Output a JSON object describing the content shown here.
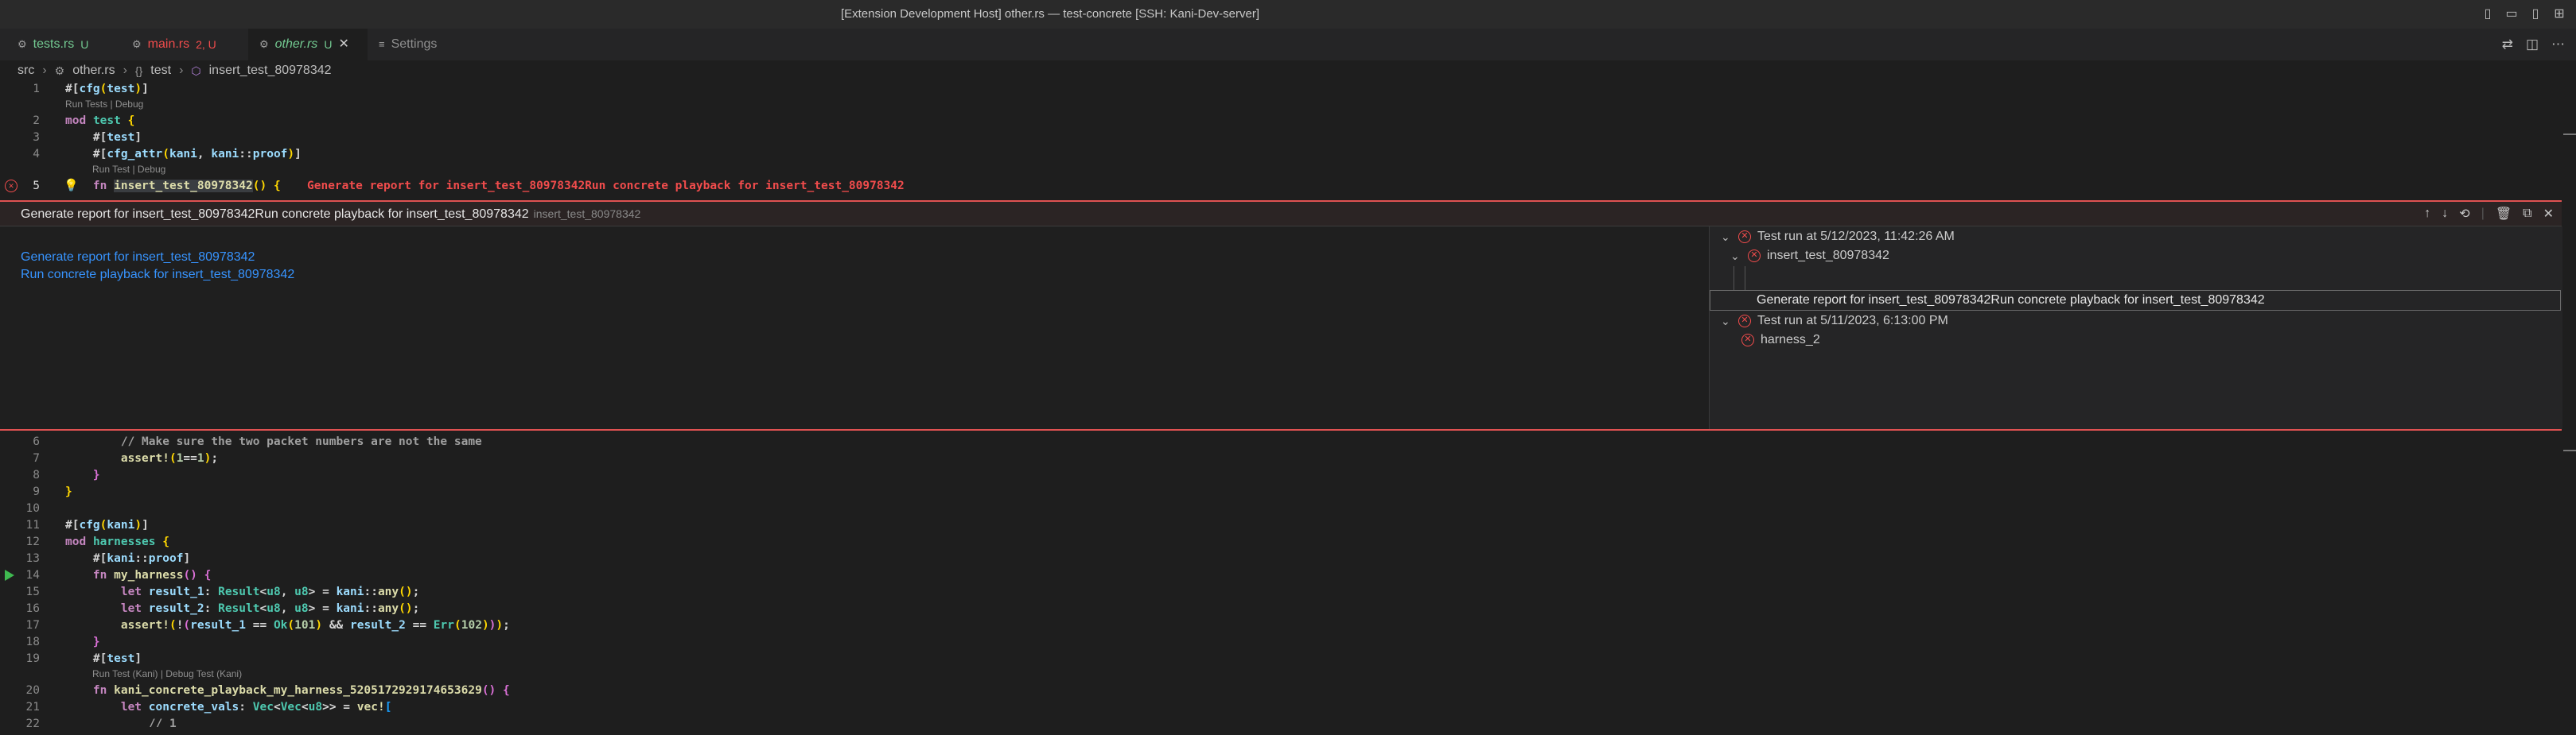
{
  "window": {
    "title": "[Extension Development Host] other.rs — test-concrete [SSH: Kani-Dev-server]"
  },
  "tabs": [
    {
      "icon": "rust-file-icon",
      "name": "tests.rs",
      "status": "U",
      "color": "#73c991"
    },
    {
      "icon": "rust-file-icon",
      "name": "main.rs",
      "status": "2, U",
      "color": "#f14c4c"
    },
    {
      "icon": "rust-file-icon",
      "name": "other.rs",
      "status": "U",
      "color": "#73c991",
      "active": true
    },
    {
      "icon": "settings-icon",
      "name": "Settings",
      "status": ""
    }
  ],
  "breadcrumb": {
    "folder": "src",
    "file": "other.rs",
    "module": "test",
    "function": "insert_test_80978342"
  },
  "top_lines": {
    "n1": "1",
    "n2": "2",
    "n3": "3",
    "n4": "4",
    "n5": "5",
    "lens1": "Run Tests | Debug",
    "lens2": "Run Test | Debug",
    "inline_error": "Generate report for insert_test_80978342Run concrete playback for insert_test_80978342"
  },
  "peek": {
    "title": "Generate report for insert_test_80978342Run concrete playback for insert_test_80978342",
    "subtitle": "insert_test_80978342",
    "links": [
      "Generate report for insert_test_80978342",
      "Run concrete playback for insert_test_80978342"
    ],
    "tree": {
      "run1": "Test run at 5/12/2023, 11:42:26 AM",
      "test1": "insert_test_80978342",
      "message": "Generate report for insert_test_80978342Run concrete playback for insert_test_80978342",
      "run2": "Test run at 5/11/2023, 6:13:00 PM",
      "test2": "harness_2"
    }
  },
  "bottom_lines": {
    "n6": "6",
    "n7": "7",
    "n8": "8",
    "n9": "9",
    "n10": "10",
    "n11": "11",
    "n12": "12",
    "n13": "13",
    "n14": "14",
    "n15": "15",
    "n16": "16",
    "n17": "17",
    "n18": "18",
    "n19": "19",
    "n20": "20",
    "n21": "21",
    "n22": "22",
    "comment": "// Make sure the two packet numbers are not the same",
    "lens3": "Run Test (Kani) | Debug Test (Kani)"
  },
  "colors": {
    "error": "#f14c4c",
    "link": "#3794ff",
    "run": "#3fb950"
  }
}
